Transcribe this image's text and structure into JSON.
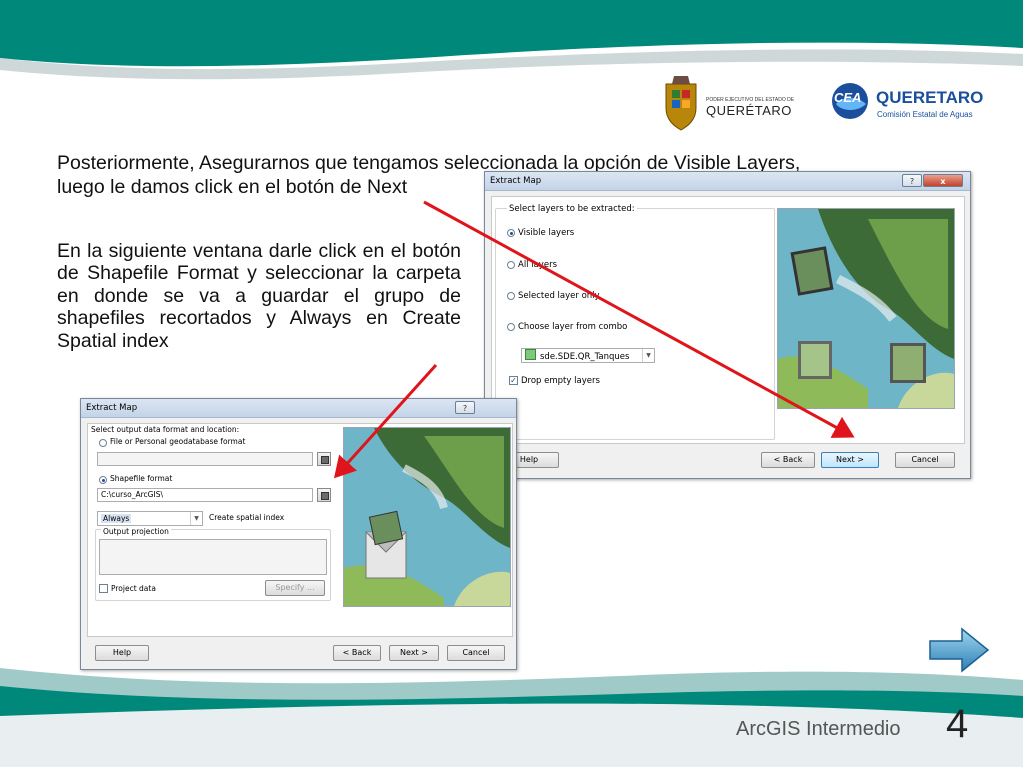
{
  "slide": {
    "intro_line1": "Posteriormente, Asegurarnos que tengamos seleccionada la opción de Visible Layers,",
    "intro_line2": "luego le damos click en el botón de Next",
    "body": "En la siguiente ventana  darle click en el botón de Shapefile Format y seleccionar la carpeta en donde se va a guardar el grupo de shapefiles recortados y Always en Create Spatial index",
    "footer_title": "ArcGIS Intermedio",
    "page_number": "4"
  },
  "logos": {
    "state_small": "PODER EJECUTIVO DEL ESTADO DE",
    "state_name": "QUERÉTARO",
    "cea_mark": "CEA",
    "cea_name": "QUERETARO",
    "cea_sub": "Comisión Estatal de Aguas"
  },
  "dialog1": {
    "title": "Extract Map",
    "help_glyph": "?",
    "close_glyph": "x",
    "group_label": "Select layers to be extracted:",
    "opt_visible": "Visible layers",
    "opt_all": "All layers",
    "opt_selected": "Selected layer only",
    "opt_combo": "Choose layer from combo",
    "combo_value": "sde.SDE.QR_Tanques",
    "drop_empty": "Drop empty layers",
    "btn_help": "Help",
    "btn_back": "< Back",
    "btn_next": "Next >",
    "btn_cancel": "Cancel"
  },
  "dialog2": {
    "title": "Extract Map",
    "help_glyph": "?",
    "group_label": "Select output data format and location:",
    "opt_file": "File or Personal geodatabase format",
    "opt_shape": "Shapefile format",
    "path": "C:\\curso_ArcGIS\\",
    "spatial_value": "Always",
    "spatial_label": "Create spatial index",
    "projection_label": "Output projection",
    "project_data": "Project data",
    "btn_specify": "Specify ...",
    "btn_help": "Help",
    "btn_back": "< Back",
    "btn_next": "Next >",
    "btn_cancel": "Cancel"
  },
  "colors": {
    "wave_dark": "#00897b",
    "wave_light": "#4fb3b0",
    "annotation_arrow": "#e0141b",
    "nav_arrow": "#3a8fc2",
    "cea_blue": "#1b4f9c"
  },
  "icons": {
    "nav": "right-arrow-icon",
    "save": "save-disk-icon",
    "radio_selected": "radio-selected",
    "checkbox_checked": "checkbox-checked"
  }
}
